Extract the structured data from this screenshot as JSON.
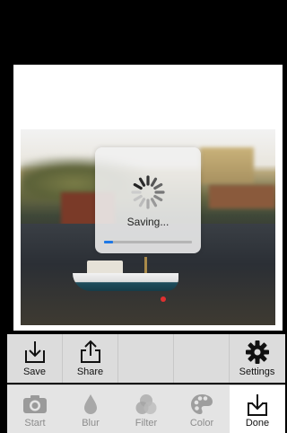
{
  "saving": {
    "label": "Saving...",
    "progress": 0.1
  },
  "actions": [
    {
      "label": "Save",
      "icon": "save-icon"
    },
    {
      "label": "Share",
      "icon": "share-icon"
    },
    {
      "label": "",
      "icon": ""
    },
    {
      "label": "",
      "icon": ""
    },
    {
      "label": "Settings",
      "icon": "gear-icon"
    }
  ],
  "tabs": [
    {
      "label": "Start",
      "icon": "camera-icon",
      "active": false
    },
    {
      "label": "Blur",
      "icon": "drop-icon",
      "active": false
    },
    {
      "label": "Filter",
      "icon": "filter-circles-icon",
      "active": false
    },
    {
      "label": "Color",
      "icon": "palette-icon",
      "active": false
    },
    {
      "label": "Done",
      "icon": "done-download-icon",
      "active": true
    }
  ],
  "colors": {
    "accent": "#1e78e6",
    "tab_active_bg": "#ffffff",
    "bar_bg": "#dcdcdc",
    "inactive_text": "#8c8c8c"
  }
}
